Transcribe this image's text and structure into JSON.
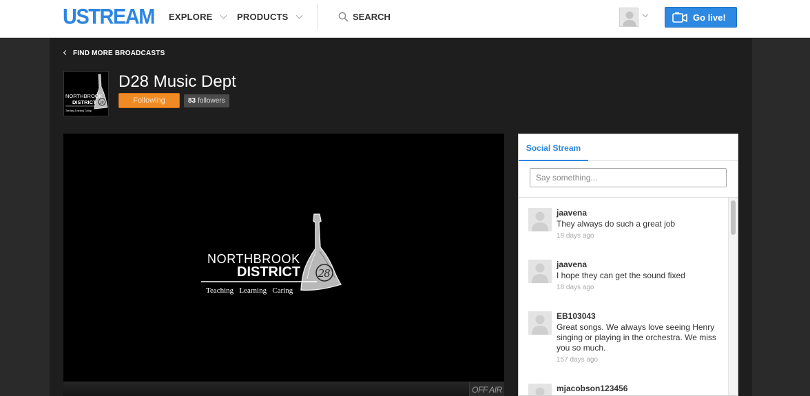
{
  "header": {
    "logo": "USTREAM",
    "nav": [
      {
        "label": "EXPLORE"
      },
      {
        "label": "PRODUCTS"
      }
    ],
    "search_label": "SEARCH",
    "golive_label": "Go live!"
  },
  "channel": {
    "back_link": "FIND MORE BROADCASTS",
    "title": "D28 Music Dept",
    "follow_label": "Following",
    "followers_count": "83",
    "followers_label": "followers",
    "logo_line1": "NORTHBROOK",
    "logo_line2": "DISTRICT",
    "logo_number": "28",
    "logo_tagline": "Teaching   Learning   Caring"
  },
  "player": {
    "status": "OFF AIR"
  },
  "social": {
    "tab_label": "Social Stream",
    "input_placeholder": "Say something...",
    "posts": [
      {
        "user": "jaavena",
        "text": "They always do such a great job",
        "time": "18 days ago"
      },
      {
        "user": "jaavena",
        "text": "I hope they can get the sound fixed",
        "time": "18 days ago"
      },
      {
        "user": "EB103043",
        "text": "Great songs. We always love seeing Henry singing or playing in the orchestra. We miss you so much.",
        "time": "157 days ago"
      },
      {
        "user": "mjacobson123456",
        "text": "",
        "time": ""
      }
    ]
  }
}
